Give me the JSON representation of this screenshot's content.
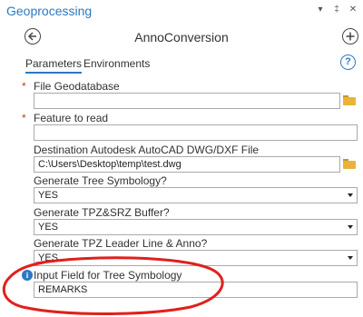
{
  "titlebar": {
    "title": "Geoprocessing",
    "controls": [
      "▾",
      "‡",
      "✕"
    ]
  },
  "toolbar": {
    "back_icon": "back-arrow-icon",
    "tool_name": "AnnoConversion",
    "add_icon": "add-icon"
  },
  "tabs": {
    "parameters": "Parameters",
    "environments": "Environments",
    "help": "?"
  },
  "params": {
    "file_gdb": {
      "label": "File Geodatabase",
      "value": "",
      "required": true
    },
    "feature_to_read": {
      "label": "Feature to read",
      "value": "",
      "required": true
    },
    "destination": {
      "label": "Destination Autodesk AutoCAD DWG/DXF File",
      "value": "C:\\Users\\Desktop\\temp\\test.dwg"
    },
    "tree_symbology": {
      "label": "Generate Tree Symbology?",
      "value": "YES"
    },
    "tpz_buffer": {
      "label": "Generate TPZ&SRZ Buffer?",
      "value": "YES"
    },
    "tpz_leader": {
      "label": "Generate TPZ Leader Line & Anno?",
      "value": "YES"
    },
    "input_field": {
      "label": "Input Field for Tree Symbology",
      "value": "REMARKS",
      "info_icon": "i"
    }
  },
  "colors": {
    "accent": "#2b79c2",
    "required": "#c0392b",
    "annotation": "#e0201c",
    "folder": "#e8b33a"
  }
}
